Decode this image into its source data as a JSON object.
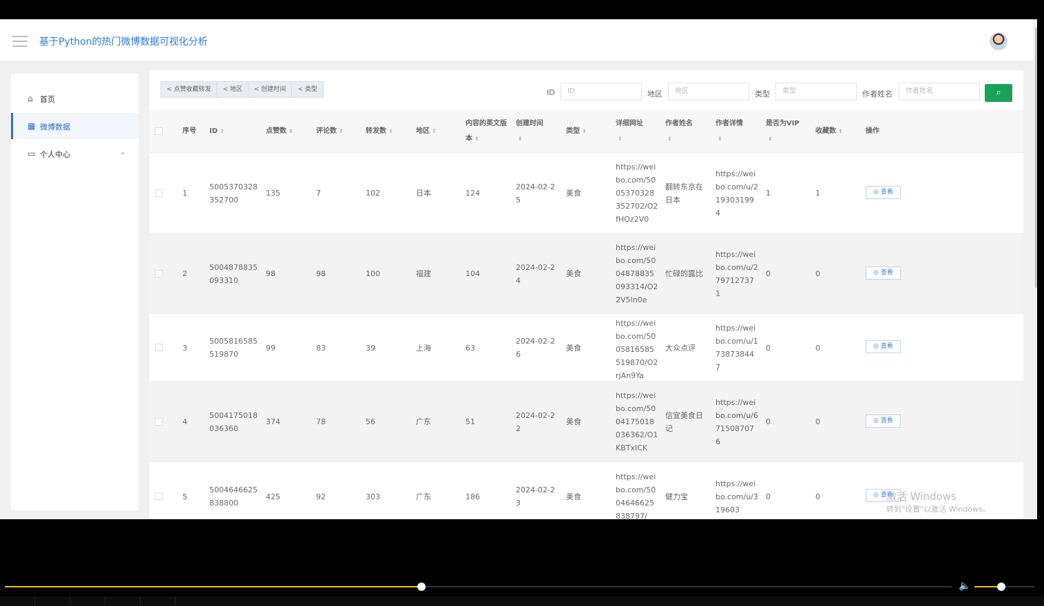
{
  "header": {
    "title": "基于Python的热门微博数据可视化分析"
  },
  "sidebar": {
    "items": [
      {
        "label": "首页",
        "icon": "home-icon"
      },
      {
        "label": "微博数据",
        "icon": "table-icon"
      },
      {
        "label": "个人中心",
        "icon": "calendar-icon"
      }
    ]
  },
  "toolbar": {
    "buttons": [
      "点赞收藏转发",
      "地区",
      "创建时间",
      "类型"
    ]
  },
  "filters": {
    "id_label": "ID",
    "id_placeholder": "ID",
    "region_label": "地区",
    "region_placeholder": "地区",
    "type_label": "类型",
    "type_placeholder": "类型",
    "author_label": "作者姓名",
    "author_placeholder": "作者姓名"
  },
  "table": {
    "headers": {
      "index": "序号",
      "id": "ID",
      "likes": "点赞数",
      "comments": "评论数",
      "reposts": "转发数",
      "region": "地区",
      "en_version": "内容的英文版本",
      "created": "创建时间",
      "type": "类型",
      "url": "详细网址",
      "author": "作者姓名",
      "author_detail": "作者详情",
      "vip": "是否为VIP",
      "favorites": "收藏数",
      "action": "操作"
    },
    "view_label": "查看",
    "rows": [
      {
        "index": "1",
        "id": "5005370328352700",
        "likes": "135",
        "comments": "7",
        "reposts": "102",
        "region": "日本",
        "en_version": "124",
        "created": "2024-02-25",
        "type": "美食",
        "url": "https://weibo.com/5005370328352702/O2fHOz2V0",
        "author": "翻转东京在日本",
        "author_detail": "https://weibo.com/u/2193031994",
        "vip": "1",
        "favorites": "1"
      },
      {
        "index": "2",
        "id": "5004878835093310",
        "likes": "98",
        "comments": "98",
        "reposts": "100",
        "region": "福建",
        "en_version": "104",
        "created": "2024-02-24",
        "type": "美食",
        "url": "https://weibo.com/5004878835093314/O22V5In0e",
        "author": "忙碌的露比",
        "author_detail": "https://weibo.com/u/2797127371",
        "vip": "0",
        "favorites": "0"
      },
      {
        "index": "3",
        "id": "5005816585519870",
        "likes": "99",
        "comments": "83",
        "reposts": "39",
        "region": "上海",
        "en_version": "63",
        "created": "2024-02-26",
        "type": "美食",
        "url": "https://weibo.com/5005816585519870/O2rjAn9Ya",
        "author": "大众点评",
        "author_detail": "https://weibo.com/u/1738738447",
        "vip": "0",
        "favorites": "0"
      },
      {
        "index": "4",
        "id": "5004175018036360",
        "likes": "374",
        "comments": "78",
        "reposts": "56",
        "region": "广东",
        "en_version": "51",
        "created": "2024-02-22",
        "type": "美食",
        "url": "https://weibo.com/5004175018036362/O1KBTxICK",
        "author": "信宜美食日记",
        "author_detail": "https://weibo.com/u/6715087076",
        "vip": "0",
        "favorites": "0"
      },
      {
        "index": "5",
        "id": "5004646625838800",
        "likes": "425",
        "comments": "92",
        "reposts": "303",
        "region": "广东",
        "en_version": "186",
        "created": "2024-02-23",
        "type": "美食",
        "url": "https://weibo.com/5004646625838797/",
        "author": "健力宝",
        "author_detail": "https://weibo.com/u/319603",
        "vip": "0",
        "favorites": "0"
      }
    ]
  },
  "watermark": {
    "line1": "激活 Windows",
    "line2": "转到\"设置\"以激活 Windows。"
  },
  "player": {
    "progress": 0.44,
    "volume": 0.45
  }
}
